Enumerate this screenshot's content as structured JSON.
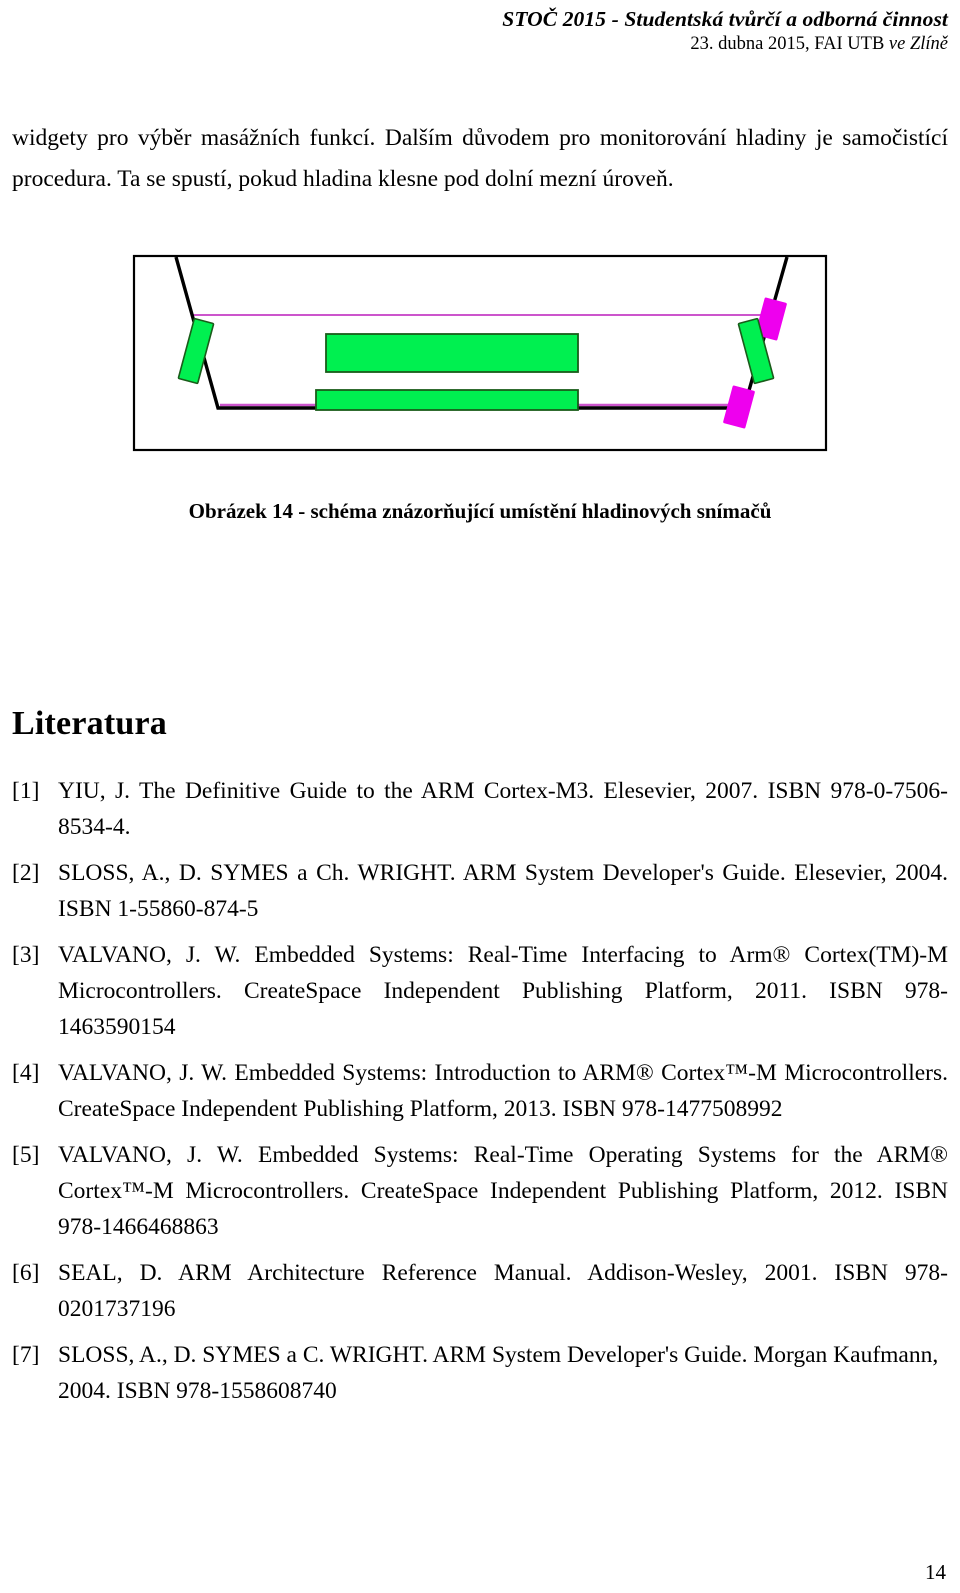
{
  "running_head": {
    "line1": "STOČ 2015 - Studentská tvůrčí a odborná činnost",
    "line2_plain": "23. dubna 2015, FAI UTB ",
    "line2_italic": "ve Zlíně"
  },
  "body": {
    "paragraph": "widgety pro výběr masážních funkcí. Dalším důvodem pro monitorování hladiny je samočistící procedura. Ta se spustí, pokud hladina klesne pod dolní mezní úroveň."
  },
  "figure": {
    "caption": "Obrázek 14 - schéma znázorňující umístění hladinových snímačů",
    "colors": {
      "outline": "#000000",
      "jet_green": "#00f050",
      "sensor_magenta": "#ee00ee",
      "water_line_violet": "#cc55cc",
      "green_stroke": "#1a5c1a"
    },
    "elements": [
      "outer-tub-frame",
      "left-slanted-wall",
      "right-slanted-wall",
      "upper-water-level-line",
      "lower-water-level-line",
      "left-wall-green-panel",
      "right-wall-green-panel",
      "center-upper-green-panel",
      "center-lower-green-panel",
      "right-upper-magenta-sensor",
      "right-lower-magenta-sensor"
    ]
  },
  "section": {
    "title": "Literatura"
  },
  "references": [
    {
      "marker": "[1]",
      "text": "YIU, J. The Definitive Guide to the ARM Cortex-M3. Elesevier, 2007. ISBN 978-0-7506-8534-4."
    },
    {
      "marker": "[2]",
      "text": "SLOSS, A., D. SYMES a Ch. WRIGHT. ARM System Developer's Guide. Elesevier, 2004. ISBN 1-55860-874-5"
    },
    {
      "marker": "[3]",
      "text": "VALVANO, J. W. Embedded Systems: Real-Time Interfacing to Arm® Cortex(TM)-M Microcontrollers. CreateSpace Independent Publishing Platform, 2011. ISBN 978-1463590154"
    },
    {
      "marker": "[4]",
      "text": "VALVANO, J. W. Embedded Systems: Introduction to ARM® Cortex™-M Microcontrollers. CreateSpace Independent Publishing Platform, 2013. ISBN 978-1477508992"
    },
    {
      "marker": "[5]",
      "text": "VALVANO, J. W. Embedded Systems: Real-Time Operating Systems for the ARM® Cortex™-M Microcontrollers. CreateSpace Independent Publishing Platform, 2012. ISBN 978-1466468863"
    },
    {
      "marker": "[6]",
      "text": "SEAL, D. ARM Architecture Reference Manual. Addison-Wesley, 2001. ISBN 978-0201737196"
    },
    {
      "marker": "[7]",
      "text": "SLOSS, A., D. SYMES a C. WRIGHT. ARM System Developer's Guide. Morgan Kaufmann, 2004. ISBN 978-1558608740"
    }
  ],
  "footer": {
    "page_number": "14"
  }
}
